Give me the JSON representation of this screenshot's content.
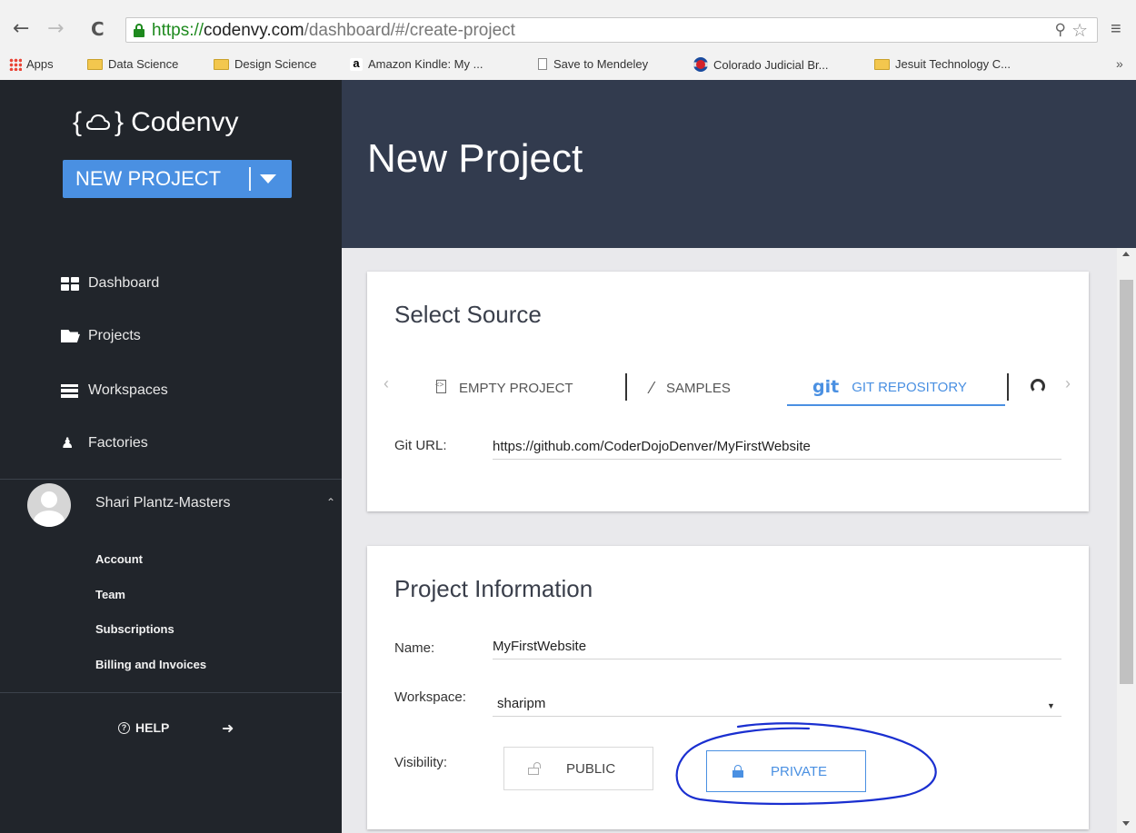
{
  "browser": {
    "url_scheme": "https://",
    "url_host": "codenvy.com",
    "url_path": "/dashboard/#/create-project",
    "bookmarks": [
      {
        "label": "Apps",
        "icon": "apps-grid-icon"
      },
      {
        "label": "Data Science",
        "icon": "folder-icon"
      },
      {
        "label": "Design Science",
        "icon": "folder-icon"
      },
      {
        "label": "Amazon Kindle: My ...",
        "icon": "amazon-icon"
      },
      {
        "label": "Save to Mendeley",
        "icon": "document-icon"
      },
      {
        "label": "Colorado Judicial Br...",
        "icon": "colorado-flag-icon"
      },
      {
        "label": "Jesuit Technology C...",
        "icon": "folder-icon"
      }
    ],
    "overflow": "»"
  },
  "sidebar": {
    "logo_text": "Codenvy",
    "new_project_label": "NEW PROJECT",
    "nav": [
      {
        "label": "Dashboard",
        "icon": "dashboard-icon"
      },
      {
        "label": "Projects",
        "icon": "folder-open-icon"
      },
      {
        "label": "Workspaces",
        "icon": "workspaces-icon"
      },
      {
        "label": "Factories",
        "icon": "rocket-icon"
      }
    ],
    "user": {
      "name": "Shari Plantz-Masters",
      "menu": [
        "Account",
        "Team",
        "Subscriptions",
        "Billing and Invoices"
      ]
    },
    "help_label": "HELP"
  },
  "header": {
    "title": "New Project"
  },
  "select_source": {
    "title": "Select Source",
    "tabs": [
      {
        "label": "EMPTY PROJECT",
        "icon": "empty-project-icon"
      },
      {
        "label": "SAMPLES",
        "icon": "magic-wand-icon"
      },
      {
        "label": "GIT REPOSITORY",
        "icon_text": "git",
        "active": true
      },
      {
        "label": "",
        "icon": "github-icon"
      }
    ],
    "git_url_label": "Git URL:",
    "git_url_value": "https://github.com/CoderDojoDenver/MyFirstWebsite"
  },
  "project_info": {
    "title": "Project Information",
    "name_label": "Name:",
    "name_value": "MyFirstWebsite",
    "workspace_label": "Workspace:",
    "workspace_value": "sharipm",
    "visibility_label": "Visibility:",
    "visibility_options": [
      "PUBLIC",
      "PRIVATE"
    ],
    "visibility_selected": "PRIVATE"
  },
  "colors": {
    "accent": "#4a90e2",
    "sidebar_bg": "#21252b",
    "header_bg": "#323b4e",
    "annotation_ink": "#1a2fd0"
  }
}
